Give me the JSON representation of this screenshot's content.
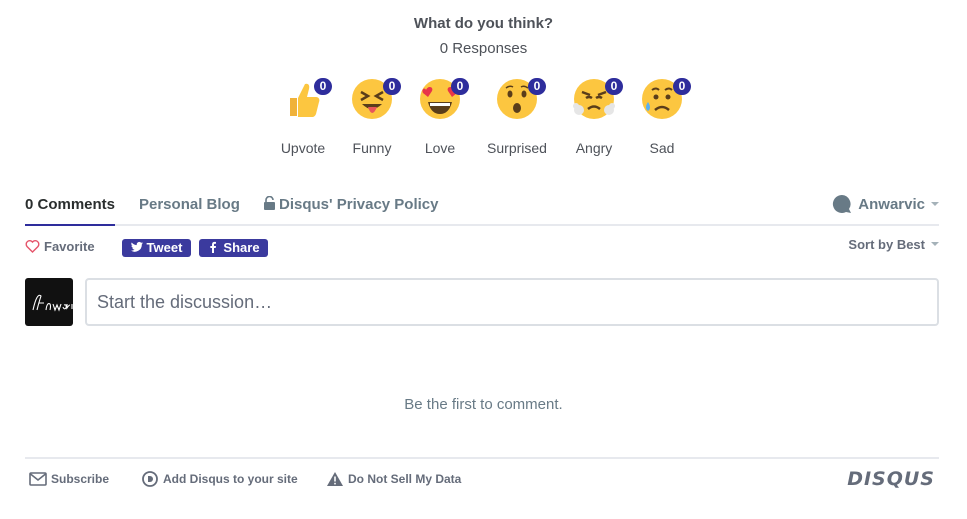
{
  "reactions": {
    "title": "What do you think?",
    "responses": "0 Responses",
    "items": [
      {
        "label": "Upvote",
        "count": "0",
        "icon": "thumbs-up-icon"
      },
      {
        "label": "Funny",
        "count": "0",
        "icon": "squinting-tongue-face-icon"
      },
      {
        "label": "Love",
        "count": "0",
        "icon": "heart-eyes-face-icon"
      },
      {
        "label": "Surprised",
        "count": "0",
        "icon": "surprised-face-icon"
      },
      {
        "label": "Angry",
        "count": "0",
        "icon": "steaming-angry-face-icon"
      },
      {
        "label": "Sad",
        "count": "0",
        "icon": "sad-sweat-face-icon"
      }
    ]
  },
  "nav": {
    "comments_tab": "0 Comments",
    "blog_tab": "Personal Blog",
    "privacy_tab": "Disqus' Privacy Policy",
    "user": "Anwarvic"
  },
  "actions": {
    "favorite": "Favorite",
    "tweet": "Tweet",
    "share": "Share",
    "sort": "Sort by Best"
  },
  "composer": {
    "placeholder": "Start the discussion…",
    "avatar_text": "Anwarvic"
  },
  "empty_message": "Be the first to comment.",
  "footer": {
    "subscribe": "Subscribe",
    "add_disqus": "Add Disqus to your site",
    "do_not_sell": "Do Not Sell My Data",
    "logo": "DISQUS"
  },
  "colors": {
    "accent": "#2e2d9c",
    "button": "#3b3a9e",
    "text_muted": "#656c7a",
    "divider": "#e7e9ee"
  }
}
